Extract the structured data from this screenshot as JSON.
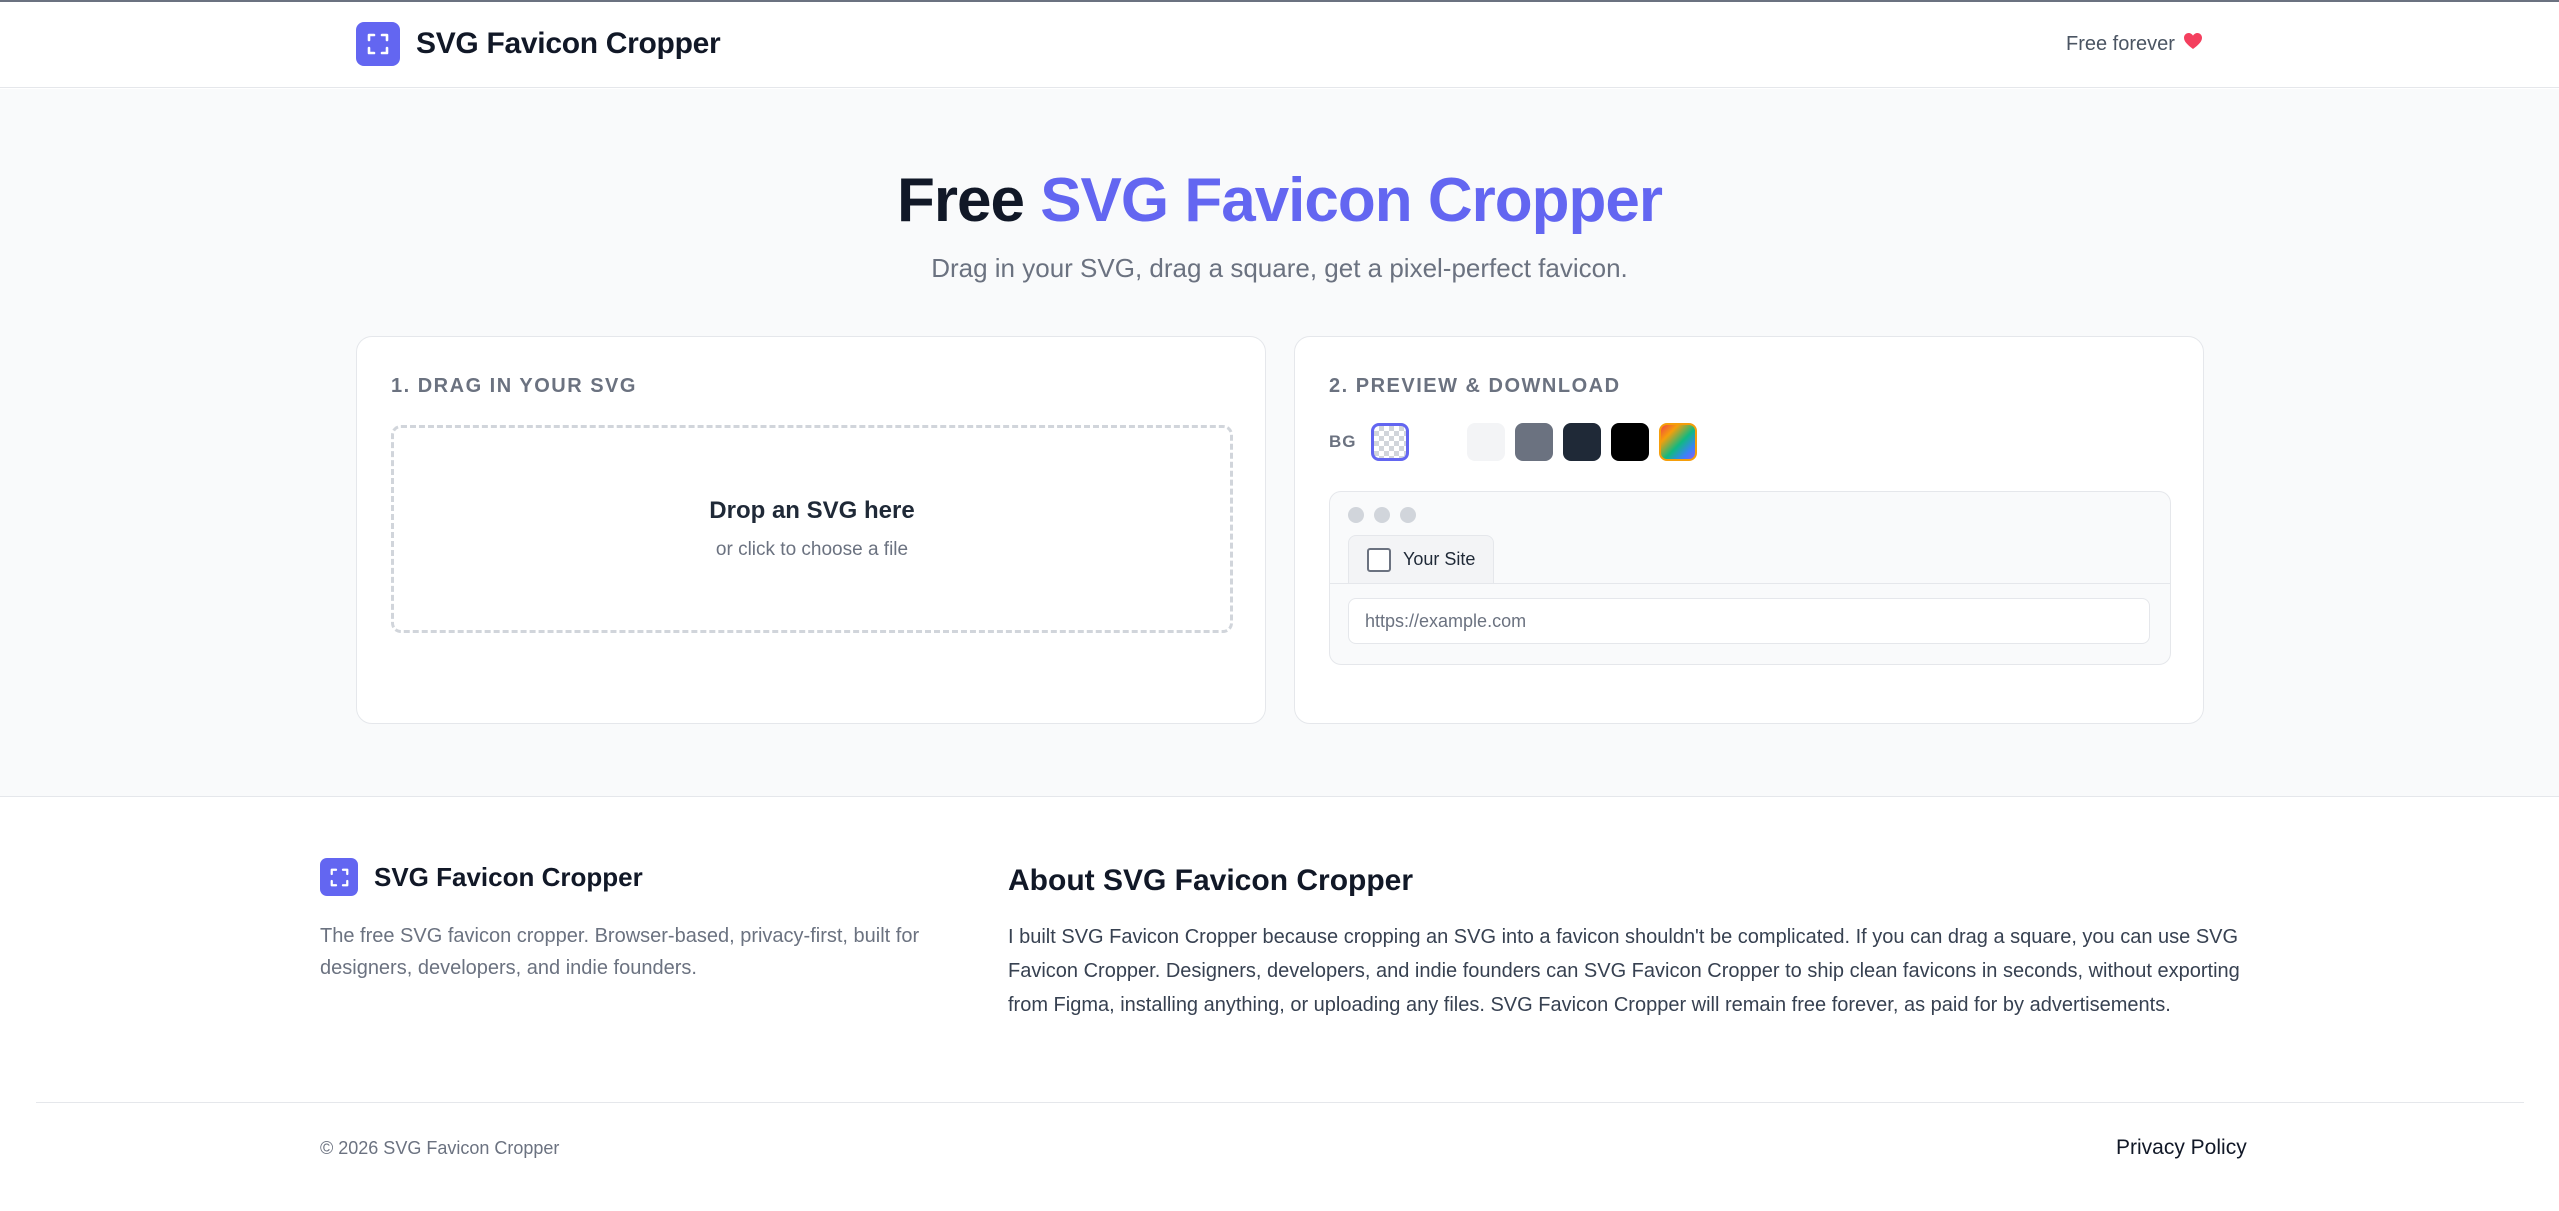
{
  "header": {
    "brand_name": "SVG Favicon Cropper",
    "logo_icon": "crop-frame-icon",
    "tagline": "Free forever",
    "tagline_icon": "heart-icon"
  },
  "hero": {
    "title_prefix": "Free ",
    "title_accent": "SVG Favicon Cropper",
    "subtitle": "Drag in your SVG, drag a square, get a pixel-perfect favicon."
  },
  "upload_card": {
    "heading": "1. DRAG IN YOUR SVG",
    "drop_title": "Drop an SVG here",
    "drop_subtitle": "or click to choose a file"
  },
  "preview_card": {
    "heading": "2. PREVIEW & DOWNLOAD",
    "bg_label": "BG",
    "backgrounds": [
      {
        "name": "transparent",
        "selected": true
      },
      {
        "name": "white",
        "color": "#ffffff"
      },
      {
        "name": "light-gray",
        "color": "#f3f4f6"
      },
      {
        "name": "gray",
        "color": "#6b7280"
      },
      {
        "name": "navy",
        "color": "#1f2937"
      },
      {
        "name": "black",
        "color": "#000000"
      },
      {
        "name": "gradient"
      }
    ],
    "browser": {
      "tab_title": "Your Site",
      "url_placeholder": "https://example.com"
    }
  },
  "footer": {
    "brand_name": "SVG Favicon Cropper",
    "description": "The free SVG favicon cropper. Browser-based, privacy-first, built for designers, developers, and indie founders.",
    "about_title": "About SVG Favicon Cropper",
    "about_body": "I built SVG Favicon Cropper because cropping an SVG into a favicon shouldn't be complicated. If you can drag a square, you can use SVG Favicon Cropper. Designers, developers, and indie founders can SVG Favicon Cropper to ship clean favicons in seconds, without exporting from Figma, installing anything, or uploading any files. SVG Favicon Cropper will remain free forever, as paid for by advertisements.",
    "copyright": "© 2026 SVG Favicon Cropper",
    "privacy_link": "Privacy Policy"
  },
  "colors": {
    "accent": "#6366f1",
    "heart": "#f43f5e",
    "text": "#111827",
    "muted": "#6b7280"
  }
}
